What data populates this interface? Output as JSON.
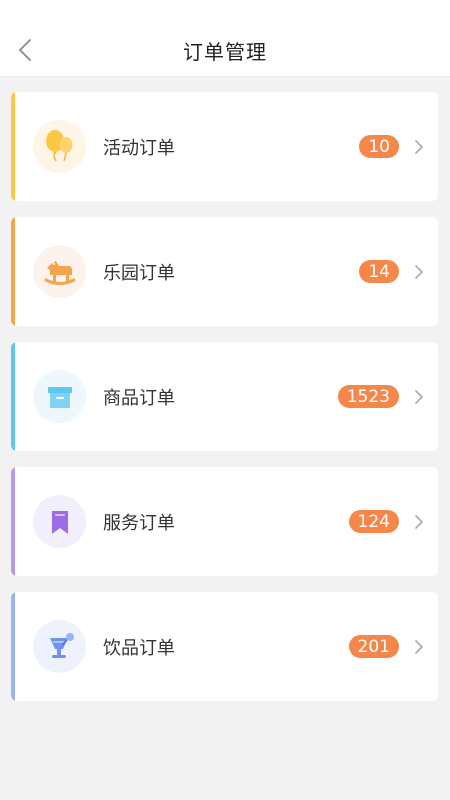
{
  "header": {
    "title": "订单管理",
    "back_icon": "chevron-left-icon"
  },
  "orders": [
    {
      "label": "活动订单",
      "count": "10",
      "accent": "#fbc744",
      "icon": "balloon-icon",
      "icon_bg": "#fdf6e6"
    },
    {
      "label": "乐园订单",
      "count": "14",
      "accent": "#f5a34c",
      "icon": "rocking-horse-icon",
      "icon_bg": "#fdf3ec"
    },
    {
      "label": "商品订单",
      "count": "1523",
      "accent": "#5ec8f0",
      "icon": "box-icon",
      "icon_bg": "#eef7fc"
    },
    {
      "label": "服务订单",
      "count": "124",
      "accent": "#b79af0",
      "icon": "bookmark-icon",
      "icon_bg": "#f3eefc"
    },
    {
      "label": "饮品订单",
      "count": "201",
      "accent": "#98b3f5",
      "icon": "drink-glass-icon",
      "icon_bg": "#eef2fc"
    }
  ],
  "colors": {
    "badge": "#f5874b",
    "chevron": "#aaaaaa"
  }
}
